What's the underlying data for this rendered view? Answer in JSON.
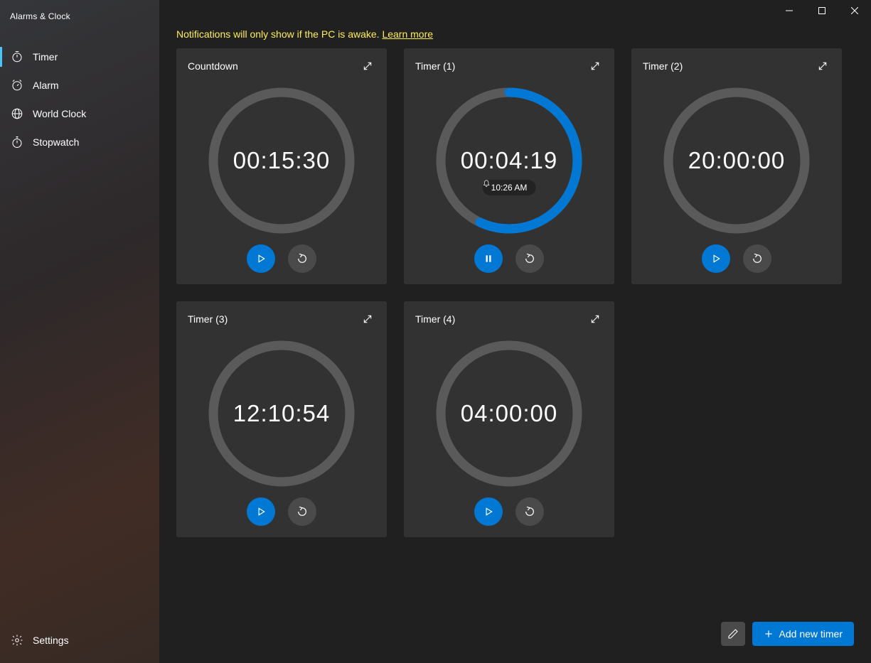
{
  "app_title": "Alarms & Clock",
  "window_controls": {
    "minimize": "–",
    "maximize": "▢",
    "close": "✕"
  },
  "sidebar": {
    "items": [
      {
        "label": "Timer",
        "icon": "timer-icon",
        "active": true
      },
      {
        "label": "Alarm",
        "icon": "alarm-icon",
        "active": false
      },
      {
        "label": "World Clock",
        "icon": "globe-icon",
        "active": false
      },
      {
        "label": "Stopwatch",
        "icon": "stopwatch-icon",
        "active": false
      }
    ],
    "settings_label": "Settings"
  },
  "notice": {
    "text": "Notifications will only show if the PC is awake. ",
    "link": "Learn more"
  },
  "timers": [
    {
      "name": "Countdown",
      "time": "00:15:30",
      "progress": 0,
      "running": false,
      "bell_time": null
    },
    {
      "name": "Timer (1)",
      "time": "00:04:19",
      "progress": 0.57,
      "running": true,
      "bell_time": "10:26 AM"
    },
    {
      "name": "Timer (2)",
      "time": "20:00:00",
      "progress": 0,
      "running": false,
      "bell_time": null
    },
    {
      "name": "Timer (3)",
      "time": "12:10:54",
      "progress": 0,
      "running": false,
      "bell_time": null
    },
    {
      "name": "Timer (4)",
      "time": "04:00:00",
      "progress": 0,
      "running": false,
      "bell_time": null
    }
  ],
  "bottom": {
    "edit_tooltip": "Edit timers",
    "add_label": "Add new timer"
  },
  "colors": {
    "accent": "#0078d4",
    "ring_bg": "#5a5a5a"
  }
}
